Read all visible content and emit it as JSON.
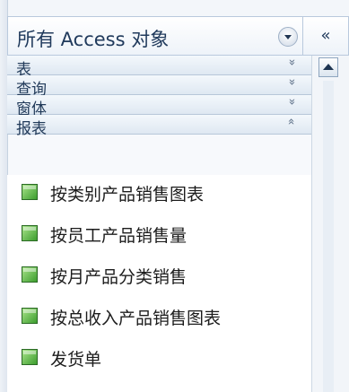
{
  "pane": {
    "title": "所有 Access 对象",
    "dropdown_icon": "chevron-down-icon",
    "collapse_label": "«"
  },
  "sections": [
    {
      "label": "表",
      "chevron": "»",
      "state": "collapsed"
    },
    {
      "label": "查询",
      "chevron": "»",
      "state": "collapsed"
    },
    {
      "label": "窗体",
      "chevron": "»",
      "state": "collapsed"
    },
    {
      "label": "报表",
      "chevron": "»",
      "state": "expanded"
    }
  ],
  "reports": [
    {
      "label": "按类别产品销售图表",
      "icon": "report-icon"
    },
    {
      "label": "按员工产品销售量",
      "icon": "report-icon"
    },
    {
      "label": "按月产品分类销售",
      "icon": "report-icon"
    },
    {
      "label": "按总收入产品销售图表",
      "icon": "report-icon"
    },
    {
      "label": "发货单",
      "icon": "report-icon"
    }
  ],
  "colors": {
    "header_text": "#203a5c",
    "section_background": "#dfe8f2",
    "report_icon": "#3c9d2e"
  }
}
